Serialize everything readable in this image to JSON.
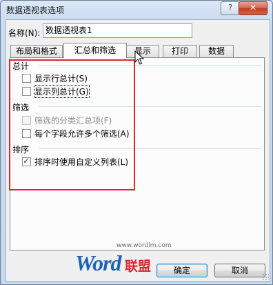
{
  "window": {
    "title": "数据透视表选项",
    "help_glyph": "?",
    "close_glyph": "✕"
  },
  "name_field": {
    "label": "名称(N):",
    "value": "数据透视表1"
  },
  "tabs": [
    {
      "label": "布局和格式",
      "active": false
    },
    {
      "label": "汇总和筛选",
      "active": true
    },
    {
      "label": "显示",
      "active": false
    },
    {
      "label": "打印",
      "active": false
    },
    {
      "label": "数据",
      "active": false
    }
  ],
  "sections": {
    "totals": {
      "title": "总计",
      "items": [
        {
          "label": "显示行总计(S)",
          "checked": false,
          "enabled": true
        },
        {
          "label": "显示列总计(G)",
          "checked": false,
          "enabled": true,
          "focused": true
        }
      ]
    },
    "filters": {
      "title": "筛选",
      "items": [
        {
          "label": "筛选的分类汇总项(F)",
          "checked": false,
          "enabled": false
        },
        {
          "label": "每个字段允许多个筛选(A)",
          "checked": false,
          "enabled": true
        }
      ]
    },
    "sorting": {
      "title": "排序",
      "items": [
        {
          "label": "排序时使用自定义列表(L)",
          "checked": true,
          "enabled": true
        }
      ]
    }
  },
  "watermark": {
    "url": "www.wordlm.com",
    "word": "Word",
    "cn": "联盟"
  },
  "buttons": {
    "ok": "确定",
    "cancel": "取消"
  },
  "colors": {
    "highlight": "#e0242f",
    "title_bar": "#c9dcf1",
    "watermark_blue": "#1f63b8",
    "watermark_red": "#d8252e"
  },
  "icons": [
    "help-icon",
    "close-icon",
    "mouse-cursor-icon",
    "resize-grip-icon"
  ]
}
